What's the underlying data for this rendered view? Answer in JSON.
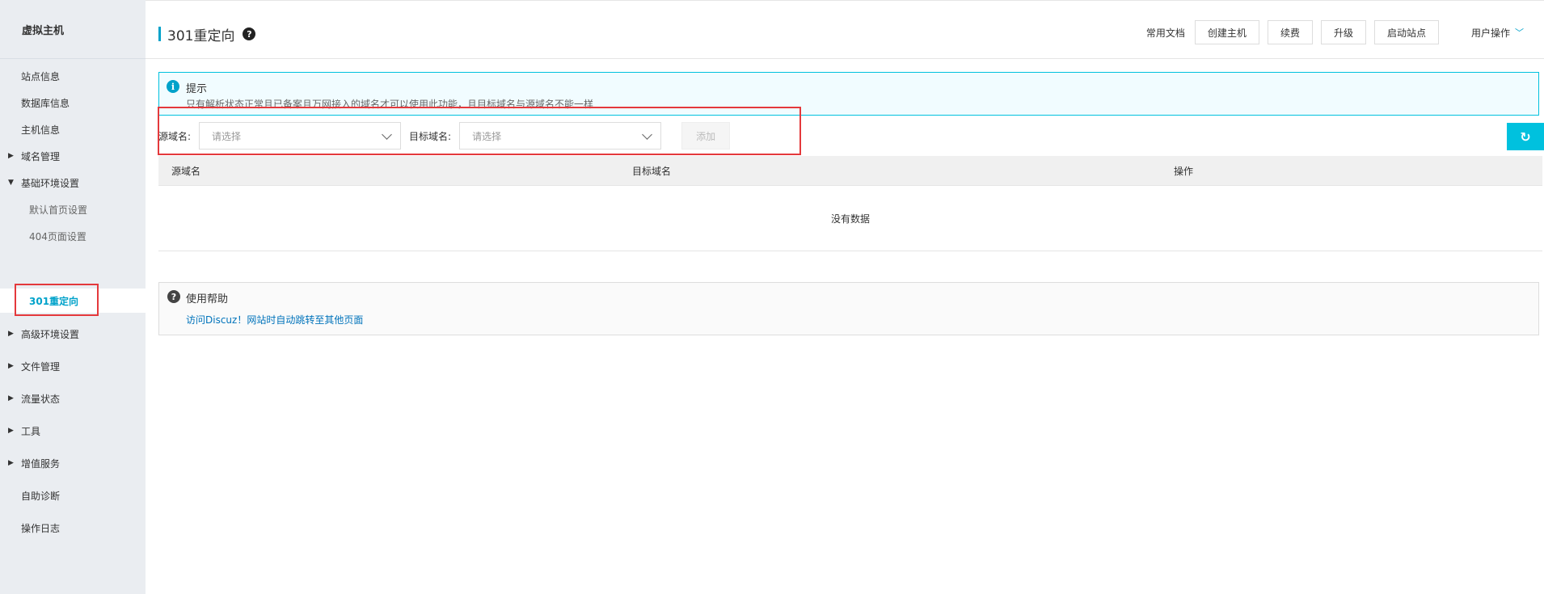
{
  "sidebar": {
    "title": "虚拟主机",
    "items": [
      {
        "label": "站点信息",
        "expandable": false
      },
      {
        "label": "数据库信息",
        "expandable": false
      },
      {
        "label": "主机信息",
        "expandable": false
      },
      {
        "label": "域名管理",
        "expandable": true,
        "expanded": false
      },
      {
        "label": "基础环境设置",
        "expandable": true,
        "expanded": true
      },
      {
        "label": "默认首页设置",
        "sub": true
      },
      {
        "label": "404页面设置",
        "sub": true
      },
      {
        "label": "301重定向",
        "sub": true,
        "active": true
      },
      {
        "label": "高级环境设置",
        "expandable": true,
        "expanded": false
      },
      {
        "label": "文件管理",
        "expandable": true,
        "expanded": false
      },
      {
        "label": "流量状态",
        "expandable": true,
        "expanded": false
      },
      {
        "label": "工具",
        "expandable": true,
        "expanded": false
      },
      {
        "label": "增值服务",
        "expandable": true,
        "expanded": false
      },
      {
        "label": "自助诊断",
        "expandable": false
      },
      {
        "label": "操作日志",
        "expandable": false
      }
    ]
  },
  "header": {
    "title": "301重定向",
    "help_icon": "question-circle-icon",
    "docs_label": "常用文档",
    "buttons": [
      "创建主机",
      "续费",
      "升级",
      "启动站点"
    ],
    "user_menu": "用户操作"
  },
  "tip": {
    "icon": "info-circle-icon",
    "title": "提示",
    "text": "只有解析状态正常且已备案且万网接入的域名才可以使用此功能，且目标域名与源域名不能一样"
  },
  "form": {
    "source_label": "源域名:",
    "source_placeholder": "请选择",
    "target_label": "目标域名:",
    "target_placeholder": "请选择",
    "add_label": "添加",
    "refresh_icon": "refresh-icon"
  },
  "table": {
    "columns": [
      "源域名",
      "目标域名",
      "操作"
    ],
    "empty_text": "没有数据"
  },
  "help": {
    "icon": "question-circle-icon",
    "title": "使用帮助",
    "link": "访问Discuz！网站时自动跳转至其他页面"
  },
  "colors": {
    "accent": "#00a2ca",
    "highlight_border": "#e4393c",
    "sidebar_bg": "#eaedf1"
  }
}
